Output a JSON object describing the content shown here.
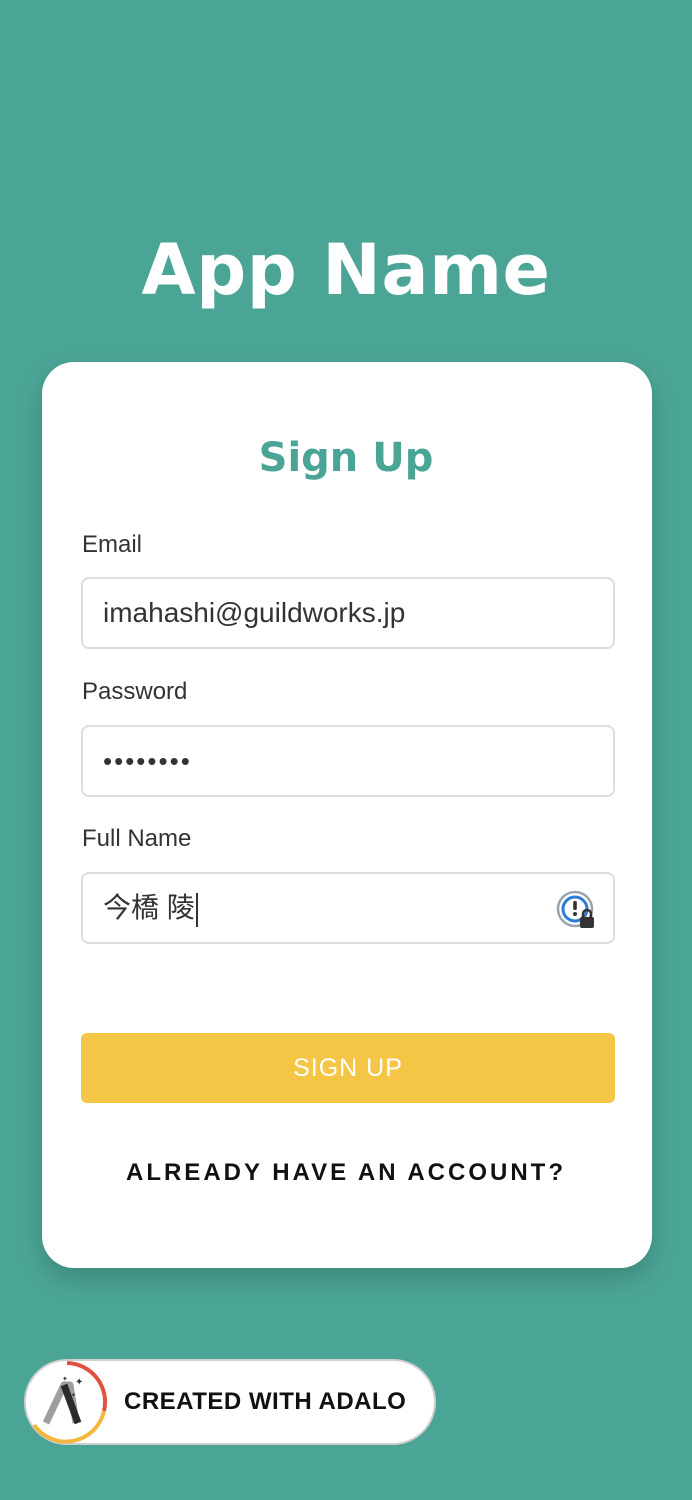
{
  "app": {
    "title": "App Name"
  },
  "form": {
    "title": "Sign Up",
    "email": {
      "label": "Email",
      "value": "imahashi@guildworks.jp"
    },
    "password": {
      "label": "Password",
      "value": "••••••••"
    },
    "full_name": {
      "label": "Full Name",
      "value": "今橋 陵",
      "icon": "password-manager-icon"
    },
    "submit_label": "SIGN UP",
    "account_link": "ALREADY HAVE AN ACCOUNT?"
  },
  "badge": {
    "text": "CREATED WITH ADALO",
    "icon": "adalo-logo-icon"
  },
  "colors": {
    "background": "#4ba596",
    "accent": "#4ba596",
    "button": "#f5c546"
  }
}
